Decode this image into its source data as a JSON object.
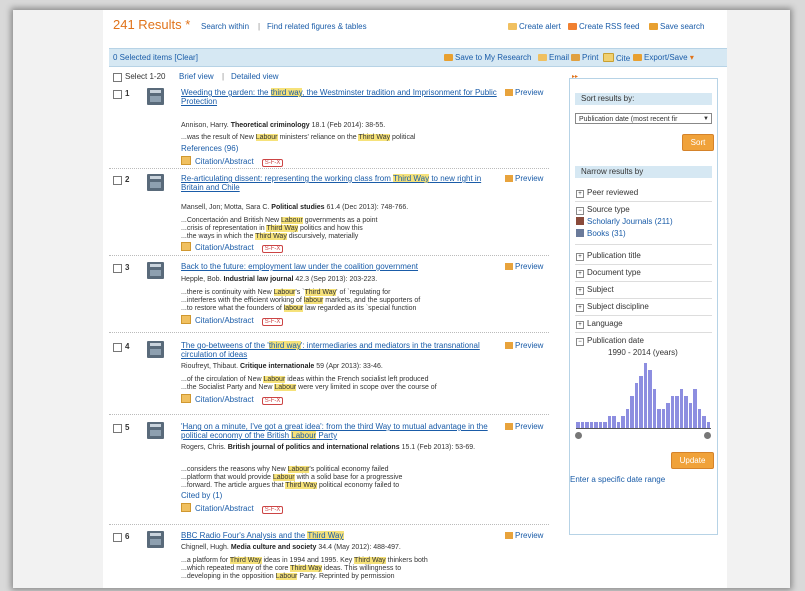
{
  "header": {
    "results_count": "241 Results",
    "star": "*",
    "search_within": "Search within",
    "separator": "|",
    "find_related": "Find related figures & tables",
    "create_alert": "Create alert",
    "create_rss": "Create RSS feed",
    "save_search": "Save search"
  },
  "selection_bar": {
    "selected": "0 Selected items [Clear]",
    "save_research": "Save to My Research",
    "email": "Email",
    "print": "Print",
    "cite": "Cite",
    "export": "Export/Save"
  },
  "views": {
    "select": "Select 1-20",
    "brief": "Brief view",
    "sep": "|",
    "detailed": "Detailed view"
  },
  "preview_label": "Preview",
  "citation_label": "Citation/Abstract",
  "sfx_label": "S-F-X",
  "results": [
    {
      "num": "1",
      "title": "Weeding the garden: the third way, the Westminster tradition and Imprisonment for Public Protection",
      "meta_author": "Annison, Harry.",
      "meta_journal": "Theoretical criminology",
      "meta_rest": "18.1 (Feb 2014): 38-55.",
      "snippets": [
        "...was the result of New Labour ministers' reliance on the Third Way political"
      ],
      "extra_link": "References (96)"
    },
    {
      "num": "2",
      "title": "Re-articulating dissent: representing the working class from Third Way to new right in Britain and Chile",
      "meta_author": "Mansell, Jon; Motta, Sara C.",
      "meta_journal": "Political studies",
      "meta_rest": "61.4 (Dec 2013): 748-766.",
      "snippets": [
        "...Concertación and British New Labour governments as a point",
        "...crisis of representation in Third Way politics and how this",
        "...the ways in which the Third Way discursively, materially"
      ]
    },
    {
      "num": "3",
      "title": "Back to the future: employment law under the coalition government",
      "meta_author": "Hepple, Bob.",
      "meta_journal": "Industrial law journal",
      "meta_rest": "42.3 (Sep 2013): 203-223.",
      "snippets": [
        "...there is continuity with New Labour's `Third Way' of `regulating for",
        "...interferes with the efficient working of labour markets, and the supporters of",
        "...to restore what the founders of labour law regarded as its `special function"
      ]
    },
    {
      "num": "4",
      "title": "The go-betweens of the 'third way': intermediaries and mediators in the transnational circulation of ideas",
      "meta_author": "Rioufreyt, Thibaut.",
      "meta_journal": "Critique internationale",
      "meta_rest": "59 (Apr 2013): 33-46.",
      "snippets": [
        "...of the circulation of New Labour ideas within the French socialist left produced",
        "...the Socialist Party and New Labour were very limited in scope over the course of"
      ]
    },
    {
      "num": "5",
      "title": "'Hang on a minute, I've got a great idea': from the third Way to mutual advantage in the political economy of the British Labour Party",
      "meta_author": "Rogers, Chris.",
      "meta_journal": "British journal of politics and international relations",
      "meta_rest": "15.1 (Feb 2013): 53-69.",
      "snippets": [
        "...considers the reasons why New Labour's political economy failed",
        "...platform that would provide Labour with a solid base for a progressive",
        "...forward. The article argues that Third Way political economy failed to"
      ],
      "extra_link": "Cited by (1)"
    },
    {
      "num": "6",
      "title": "BBC Radio Four's Analysis and the Third Way",
      "meta_author": "Chignell, Hugh.",
      "meta_journal": "Media culture and society",
      "meta_rest": "34.4 (May 2012): 488-497.",
      "snippets": [
        "...a platform for Third Way ideas in 1994 and 1995. Key Third Way thinkers both",
        "...which repeated many of the core Third Way ideas. This willingness to",
        "...developing in the opposition Labour Party. Reprinted by permission"
      ]
    }
  ],
  "sidebar": {
    "sort_header": "Sort results by:",
    "sort_value": "Publication date (most recent fir",
    "sort_button": "Sort",
    "narrow_header": "Narrow results by",
    "peer_reviewed": "Peer reviewed",
    "source_type": "Source type",
    "scholarly": "Scholarly Journals (211)",
    "books": "Books (31)",
    "pub_title": "Publication title",
    "doc_type": "Document type",
    "subject": "Subject",
    "subject_disc": "Subject discipline",
    "language": "Language",
    "pub_date": "Publication date",
    "date_span": "1990 - 2014 (years)",
    "update_button": "Update",
    "date_range_link": "Enter a specific date range"
  },
  "histogram": {
    "x_range": [
      1990,
      2014
    ],
    "values": [
      1,
      1,
      1,
      1,
      1,
      1,
      1,
      2,
      2,
      1,
      2,
      3,
      5,
      7,
      8,
      10,
      9,
      6,
      3,
      3,
      4,
      5,
      5,
      6,
      5,
      4,
      6,
      3,
      2,
      1
    ],
    "bar_color": "#8d8ee0"
  },
  "colors": {
    "accent": "#e0731a",
    "link": "#1a5ca8",
    "highlight": "#f6e27a",
    "bar_bg": "#d6e8f3"
  }
}
